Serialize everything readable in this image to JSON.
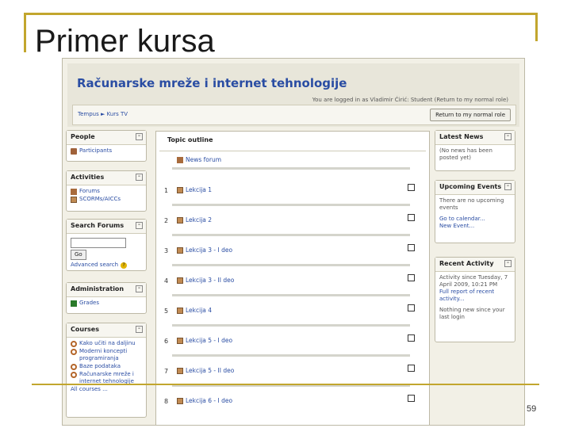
{
  "slide": {
    "title": "Primer kursa",
    "page_number": "59"
  },
  "site": {
    "title": "Računarske mreže i internet tehnologije",
    "login_info": "You are logged in as Vladimir Ćirić: Student (Return to my normal role)",
    "breadcrumb": "Tempus ► Kurs TV",
    "return_button": "Return to my normal role"
  },
  "left_blocks": {
    "people": {
      "title": "People",
      "items": [
        "Participants"
      ]
    },
    "activities": {
      "title": "Activities",
      "items": [
        "Forums",
        "SCORMs/AICCs"
      ]
    },
    "search": {
      "title": "Search Forums",
      "go": "Go",
      "advanced": "Advanced search"
    },
    "administration": {
      "title": "Administration",
      "items": [
        "Grades"
      ]
    },
    "courses": {
      "title": "Courses",
      "items": [
        "Kako učiti na daljinu",
        "Moderni koncepti programiranja",
        "Baze podataka",
        "Računarske mreže i internet tehnologije"
      ],
      "all": "All courses ..."
    }
  },
  "center": {
    "title": "Topic outline",
    "news_forum": "News forum",
    "topics": [
      {
        "num": "1",
        "label": "Lekcija 1"
      },
      {
        "num": "2",
        "label": "Lekcija 2"
      },
      {
        "num": "3",
        "label": "Lekcija 3 - I deo"
      },
      {
        "num": "4",
        "label": "Lekcija 3 - II deo"
      },
      {
        "num": "5",
        "label": "Lekcija 4"
      },
      {
        "num": "6",
        "label": "Lekcija 5 - I deo"
      },
      {
        "num": "7",
        "label": "Lekcija 5 - II deo"
      },
      {
        "num": "8",
        "label": "Lekcija 6 - I deo"
      }
    ]
  },
  "right_blocks": {
    "latest_news": {
      "title": "Latest News",
      "text": "(No news has been posted yet)"
    },
    "upcoming": {
      "title": "Upcoming Events",
      "text": "There are no upcoming events",
      "calendar": "Go to calendar...",
      "new_event": "New Event..."
    },
    "recent": {
      "title": "Recent Activity",
      "since": "Activity since Tuesday, 7 April 2009, 10:21 PM",
      "full_report": "Full report of recent activity...",
      "nothing": "Nothing new since your last login"
    }
  }
}
